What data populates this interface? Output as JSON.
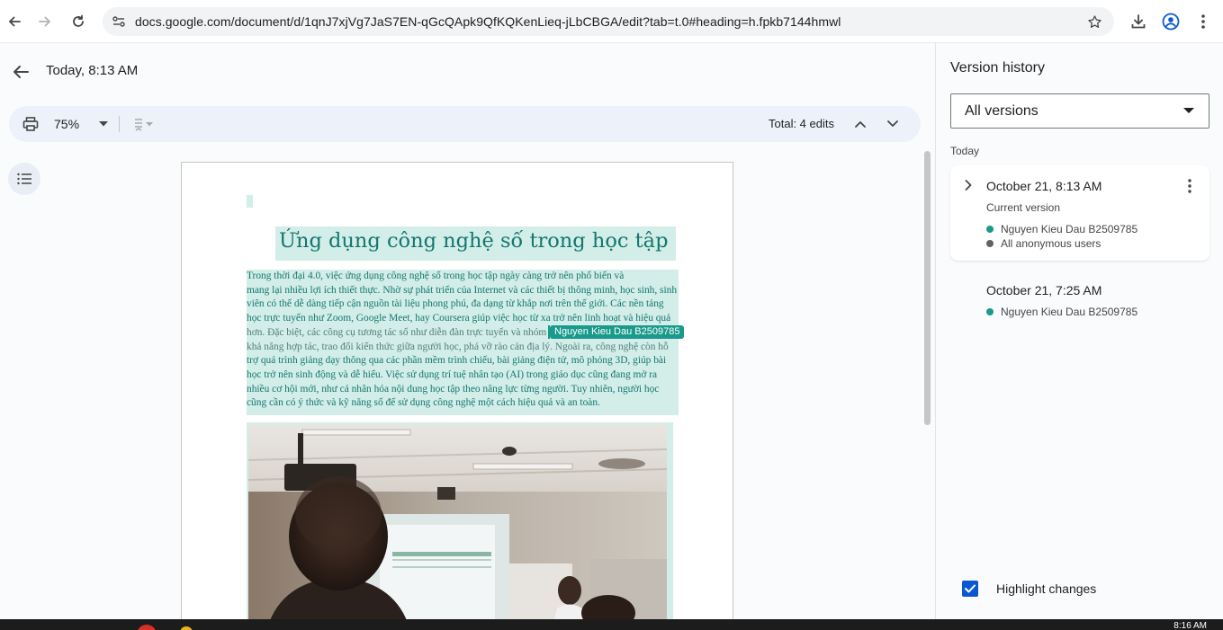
{
  "browser": {
    "url": "docs.google.com/document/d/1qnJ7xjVg7JaS7EN-qGcQApk9QfKQKenLieq-jLbCBGA/edit?tab=t.0#heading=h.fpkb7144hmwl"
  },
  "header": {
    "title": "Today, 8:13 AM"
  },
  "toolbar": {
    "zoom": "75%",
    "total_edits": "Total: 4 edits"
  },
  "document": {
    "title": "Ứng dụng công nghệ số trong học tập",
    "body_lines": [
      "            Trong thời đại 4.0, việc ứng dụng công nghệ số trong học tập ngày càng trở nên phổ biến và",
      "mang lại nhiều lợi ích thiết thực. Nhờ sự phát triển của Internet và các thiết bị thông minh, học sinh, sinh",
      "viên có thể dễ dàng tiếp cận nguồn tài liệu phong phú, đa dạng từ khắp nơi trên thế giới. Các nền tảng",
      "học trực tuyến như Zoom, Google Meet, hay Coursera giúp việc học từ xa trở nên linh hoạt và hiệu quả",
      "hơn. Đặc biệt, các công cụ tương tác số như diễn đàn trực tuyến và nhóm h",
      "khả năng hợp tác, trao đổi kiến thức giữa người học, phá vỡ rào cản địa lý. Ngoài ra, công nghệ còn hỗ",
      "trợ quá trình giảng dạy thông qua các phần mềm trình chiếu, bài giảng điện tử, mô phỏng 3D, giúp bài",
      "học trở nên sinh động và dễ hiểu. Việc sử dụng trí tuệ nhân tạo (AI) trong giáo dục cũng đang mở ra",
      "nhiều cơ hội mới, như cá nhân hóa nội dung học tập theo năng lực từng người. Tuy nhiên, người học",
      "cũng cần có ý thức và kỹ năng số để sử dụng công nghệ một cách hiệu quả và an toàn."
    ],
    "cursor_label": "Nguyen Kieu Dau B2509785",
    "photo_caption_hidden": ""
  },
  "version_history": {
    "title": "Version history",
    "filter": "All versions",
    "group_label": "Today",
    "versions": [
      {
        "date": "October 21, 8:13 AM",
        "subtitle": "Current version",
        "users": [
          {
            "name": "Nguyen Kieu Dau B2509785",
            "color": "#1a9a8c"
          },
          {
            "name": "All anonymous users",
            "color": "#5f6368"
          }
        ]
      },
      {
        "date": "October 21, 7:25 AM",
        "users": [
          {
            "name": "Nguyen Kieu Dau B2509785",
            "color": "#1a9a8c"
          }
        ]
      }
    ],
    "highlight_changes": "Highlight changes",
    "highlight_checked": true
  },
  "taskbar": {
    "clock": "8:16 AM"
  },
  "colors": {
    "accent": "#0b57d0",
    "change_highlight": "#d3ede9",
    "change_text": "#12776e",
    "author_teal": "#1a9a8c"
  },
  "icons": [
    "back-arrow-icon",
    "forward-arrow-icon",
    "reload-icon",
    "site-settings-icon",
    "star-icon",
    "download-icon",
    "profile-icon",
    "more-vert-icon",
    "print-icon",
    "chevron-down-icon",
    "editing-mode-icon",
    "chevron-up-icon",
    "outline-icon",
    "chevron-right-icon",
    "checkbox-icon"
  ]
}
